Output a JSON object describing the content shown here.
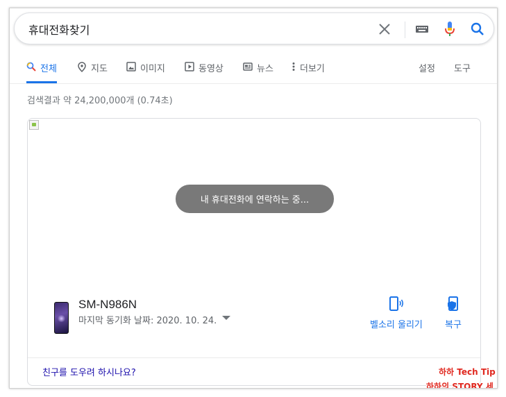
{
  "search": {
    "query": "휴대전화찾기",
    "clear_icon": "close-icon",
    "keyboard_icon": "keyboard-icon",
    "mic_icon": "microphone-icon",
    "search_icon": "search-icon"
  },
  "tabs": [
    {
      "label": "전체",
      "icon": "search-icon",
      "active": true
    },
    {
      "label": "지도",
      "icon": "map-pin-icon",
      "active": false
    },
    {
      "label": "이미지",
      "icon": "image-icon",
      "active": false
    },
    {
      "label": "동영상",
      "icon": "video-icon",
      "active": false
    },
    {
      "label": "뉴스",
      "icon": "news-icon",
      "active": false
    },
    {
      "label": "더보기",
      "icon": "more-vertical-icon",
      "active": false
    }
  ],
  "tabs_right": {
    "settings": "설정",
    "tools": "도구"
  },
  "result_stats": "검색결과 약 24,200,000개 (0.74초)",
  "find_device": {
    "toast": "내 휴대전화에 연락하는 중...",
    "device_name": "SM-N986N",
    "last_sync": "마지막 동기화 날짜: 2020. 10. 24.",
    "actions": {
      "ring": "벨소리 울리기",
      "recover": "복구"
    },
    "help_link": "친구를 도우려 하시나요?"
  },
  "watermark": {
    "line1": "하하 Tech Tip",
    "line2": "하하의 STORY 세상"
  },
  "colors": {
    "accent": "#1a73e8",
    "link": "#1a0dab",
    "toast_bg": "#797979",
    "watermark": "#e0281f"
  }
}
